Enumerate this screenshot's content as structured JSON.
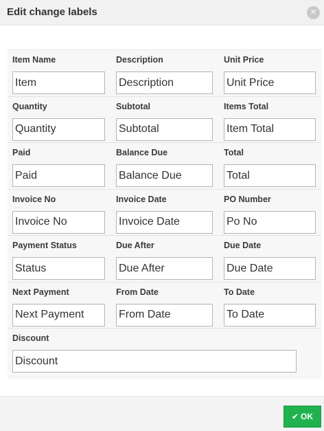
{
  "dialog": {
    "title": "Edit change labels",
    "close_icon": "close-icon",
    "ok_label": "OK",
    "ok_icon": "check-icon",
    "accent_color": "#21b24f"
  },
  "fields": [
    [
      {
        "label": "Item Name",
        "value": "Item"
      },
      {
        "label": "Description",
        "value": "Description"
      },
      {
        "label": "Unit Price",
        "value": "Unit Price"
      }
    ],
    [
      {
        "label": "Quantity",
        "value": "Quantity"
      },
      {
        "label": "Subtotal",
        "value": "Subtotal"
      },
      {
        "label": "Items Total",
        "value": "Item Total"
      }
    ],
    [
      {
        "label": "Paid",
        "value": "Paid"
      },
      {
        "label": "Balance Due",
        "value": "Balance Due"
      },
      {
        "label": "Total",
        "value": "Total"
      }
    ],
    [
      {
        "label": "Invoice No",
        "value": "Invoice No"
      },
      {
        "label": "Invoice Date",
        "value": "Invoice Date"
      },
      {
        "label": "PO Number",
        "value": "Po No"
      }
    ],
    [
      {
        "label": "Payment Status",
        "value": "Status"
      },
      {
        "label": "Due After",
        "value": "Due After"
      },
      {
        "label": "Due Date",
        "value": "Due Date"
      }
    ],
    [
      {
        "label": "Next Payment",
        "value": "Next Payment"
      },
      {
        "label": "From Date",
        "value": "From Date"
      },
      {
        "label": "To Date",
        "value": "To Date"
      }
    ],
    [
      {
        "label": "Discount",
        "value": "Discount"
      }
    ]
  ]
}
